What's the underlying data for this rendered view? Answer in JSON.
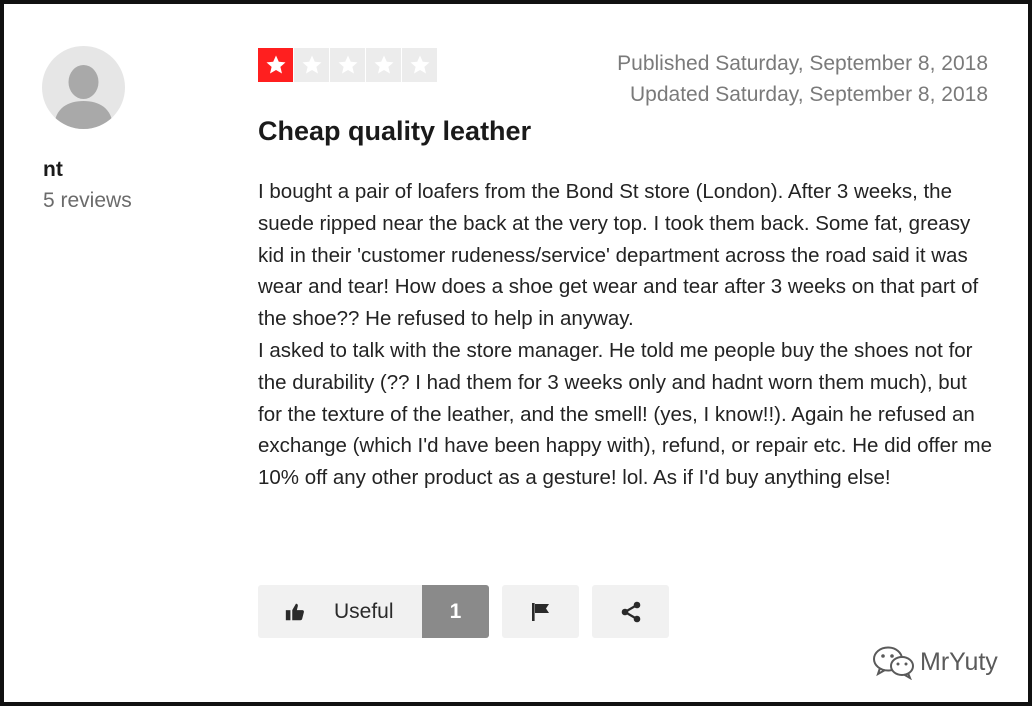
{
  "reviewer": {
    "name": "nt",
    "review_count": "5 reviews",
    "avatar_icon": "user-silhouette-icon"
  },
  "review": {
    "rating": 1,
    "rating_max": 5,
    "star_color": "#ff1f1f",
    "published": "Published Saturday, September 8, 2018",
    "updated": "Updated Saturday, September 8, 2018",
    "title": "Cheap quality leather",
    "paragraphs": [
      "I bought a pair of loafers from the Bond St store (London). After 3 weeks, the suede ripped near the back at the very top. I took them back. Some fat, greasy kid in their 'customer rudeness/service' department across the road said it was wear and tear! How does a shoe get wear and tear after 3 weeks on that part of the shoe?? He refused to help in anyway.",
      "I asked to talk with the store manager. He told me people buy the shoes not for the durability (?? I had them for 3 weeks only and hadnt worn them much), but for the texture of the leather, and the smell! (yes, I know!!). Again he refused an exchange (which I'd have been happy with), refund, or repair etc. He did offer me 10% off any other product as a gesture! lol. As if I'd buy anything else!"
    ]
  },
  "actions": {
    "useful_label": "Useful",
    "useful_count": "1",
    "useful_icon": "thumbs-up-icon",
    "flag_icon": "flag-icon",
    "share_icon": "share-icon"
  },
  "watermark": {
    "text": "MrYuty",
    "icon": "wechat-icon"
  }
}
